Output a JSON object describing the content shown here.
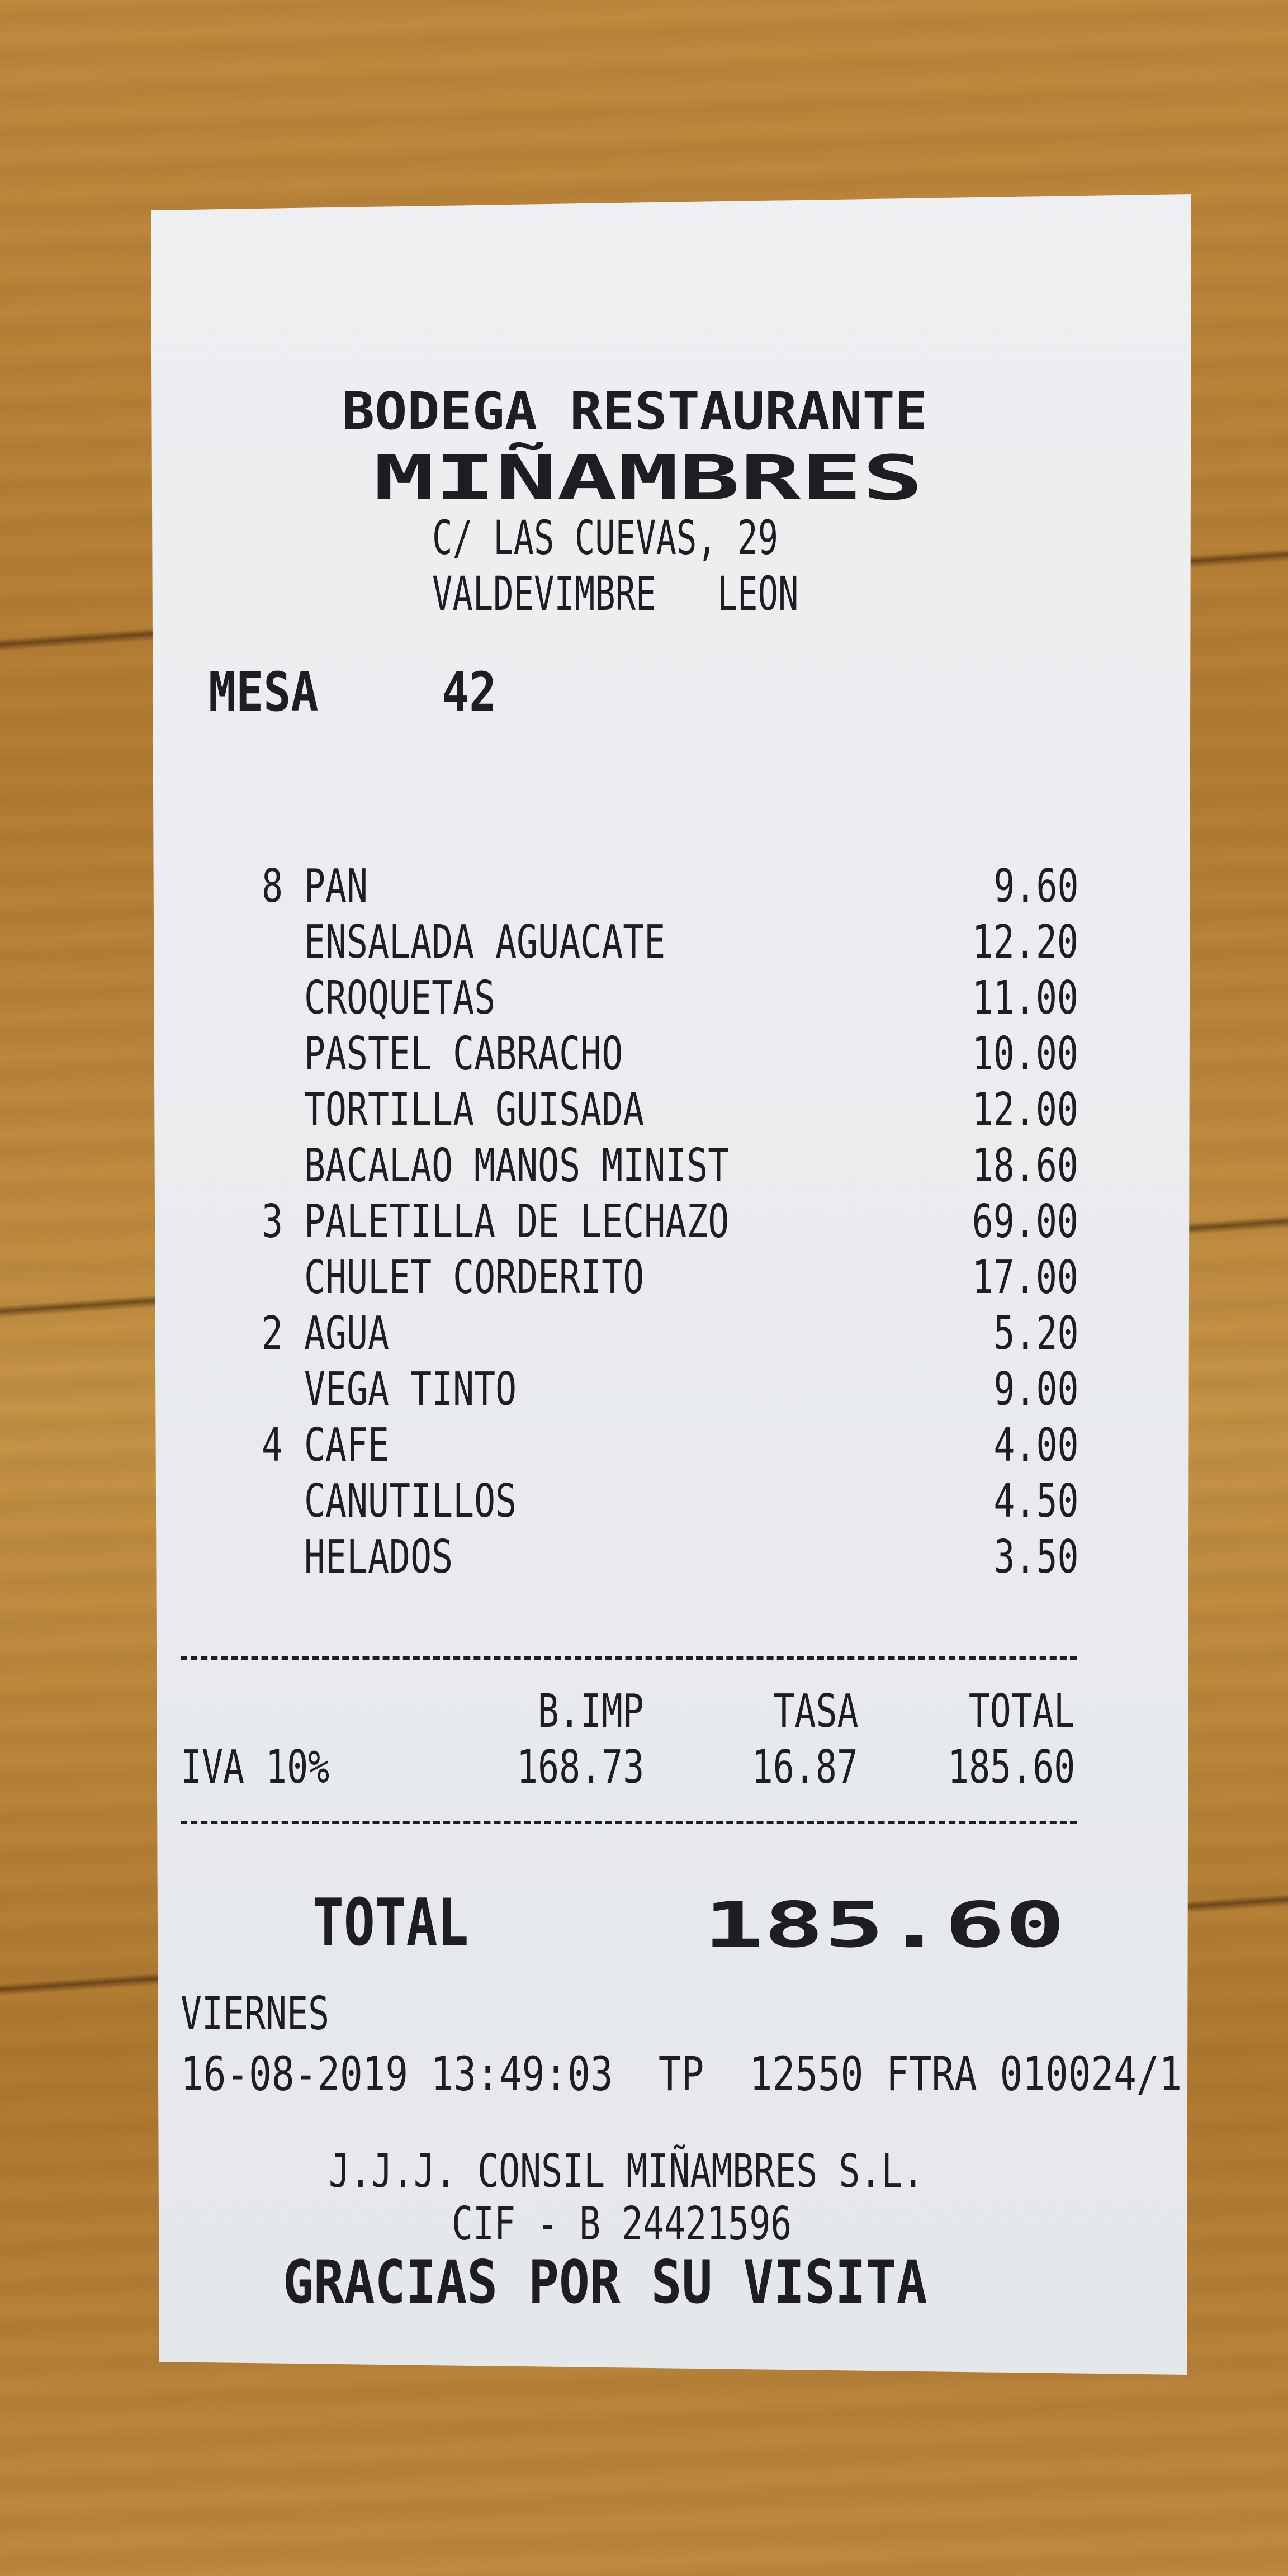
{
  "header": {
    "line1": "BODEGA RESTAURANTE",
    "name": "MIÑAMBRES",
    "address1": "C/ LAS CUEVAS, 29",
    "address2": "VALDEVIMBRE   LEON"
  },
  "table": {
    "label": "MESA",
    "number": "42"
  },
  "items": [
    {
      "qty": "8",
      "name": "PAN",
      "price": "9.60"
    },
    {
      "qty": "",
      "name": "ENSALADA AGUACATE",
      "price": "12.20"
    },
    {
      "qty": "",
      "name": "CROQUETAS",
      "price": "11.00"
    },
    {
      "qty": "",
      "name": "PASTEL CABRACHO",
      "price": "10.00"
    },
    {
      "qty": "",
      "name": "TORTILLA GUISADA",
      "price": "12.00"
    },
    {
      "qty": "",
      "name": "BACALAO MANOS MINIST",
      "price": "18.60"
    },
    {
      "qty": "3",
      "name": "PALETILLA DE LECHAZO",
      "price": "69.00"
    },
    {
      "qty": "",
      "name": "CHULET CORDERITO",
      "price": "17.00"
    },
    {
      "qty": "2",
      "name": "AGUA",
      "price": "5.20"
    },
    {
      "qty": "",
      "name": "VEGA TINTO",
      "price": "9.00"
    },
    {
      "qty": "4",
      "name": "CAFE",
      "price": "4.00"
    },
    {
      "qty": "",
      "name": "CANUTILLOS",
      "price": "4.50"
    },
    {
      "qty": "",
      "name": "HELADOS",
      "price": "3.50"
    }
  ],
  "tax": {
    "headers": [
      "B.IMP",
      "TASA",
      "TOTAL"
    ],
    "label": "IVA 10%",
    "base": "168.73",
    "rate_amount": "16.87",
    "total": "185.60"
  },
  "total": {
    "label": "TOTAL",
    "value": "185.60"
  },
  "footer": {
    "day": "VIERNES",
    "datetime_line": "16-08-2019 13:49:03  TP  12550 FTRA 010024/1",
    "company": "J.J.J. CONSIL MIÑAMBRES S.L.",
    "cif": "CIF - B 24421596",
    "thanks": "GRACIAS POR SU VISITA"
  }
}
